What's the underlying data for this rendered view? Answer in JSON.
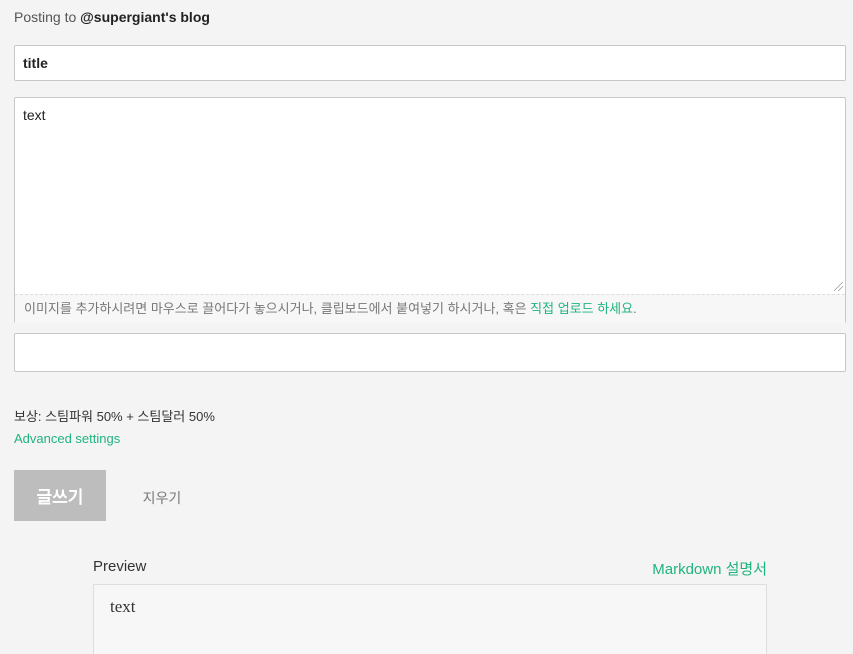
{
  "header": {
    "posting_to_prefix": "Posting to ",
    "blog_name": "@supergiant's blog"
  },
  "title_field": {
    "value": "title"
  },
  "body_field": {
    "value": "text"
  },
  "upload_hint": {
    "text": "이미지를 추가하시려면 마우스로 끌어다가 놓으시거나, 클립보드에서 붙여넣기 하시거나, 혹은 ",
    "link": "직접 업로드 하세요",
    "suffix": "."
  },
  "tags_field": {
    "value": ""
  },
  "rewards": {
    "text": "보상: 스팀파워 50% + 스팀달러 50%"
  },
  "advanced_settings": {
    "label": "Advanced settings"
  },
  "actions": {
    "post_label": "글쓰기",
    "clear_label": "지우기"
  },
  "preview": {
    "label": "Preview",
    "markdown_link": "Markdown 설명서",
    "content": "text"
  },
  "colors": {
    "accent": "#1fb47e",
    "disabled_button": "#bdbdbd",
    "background": "#f4f4f4"
  }
}
